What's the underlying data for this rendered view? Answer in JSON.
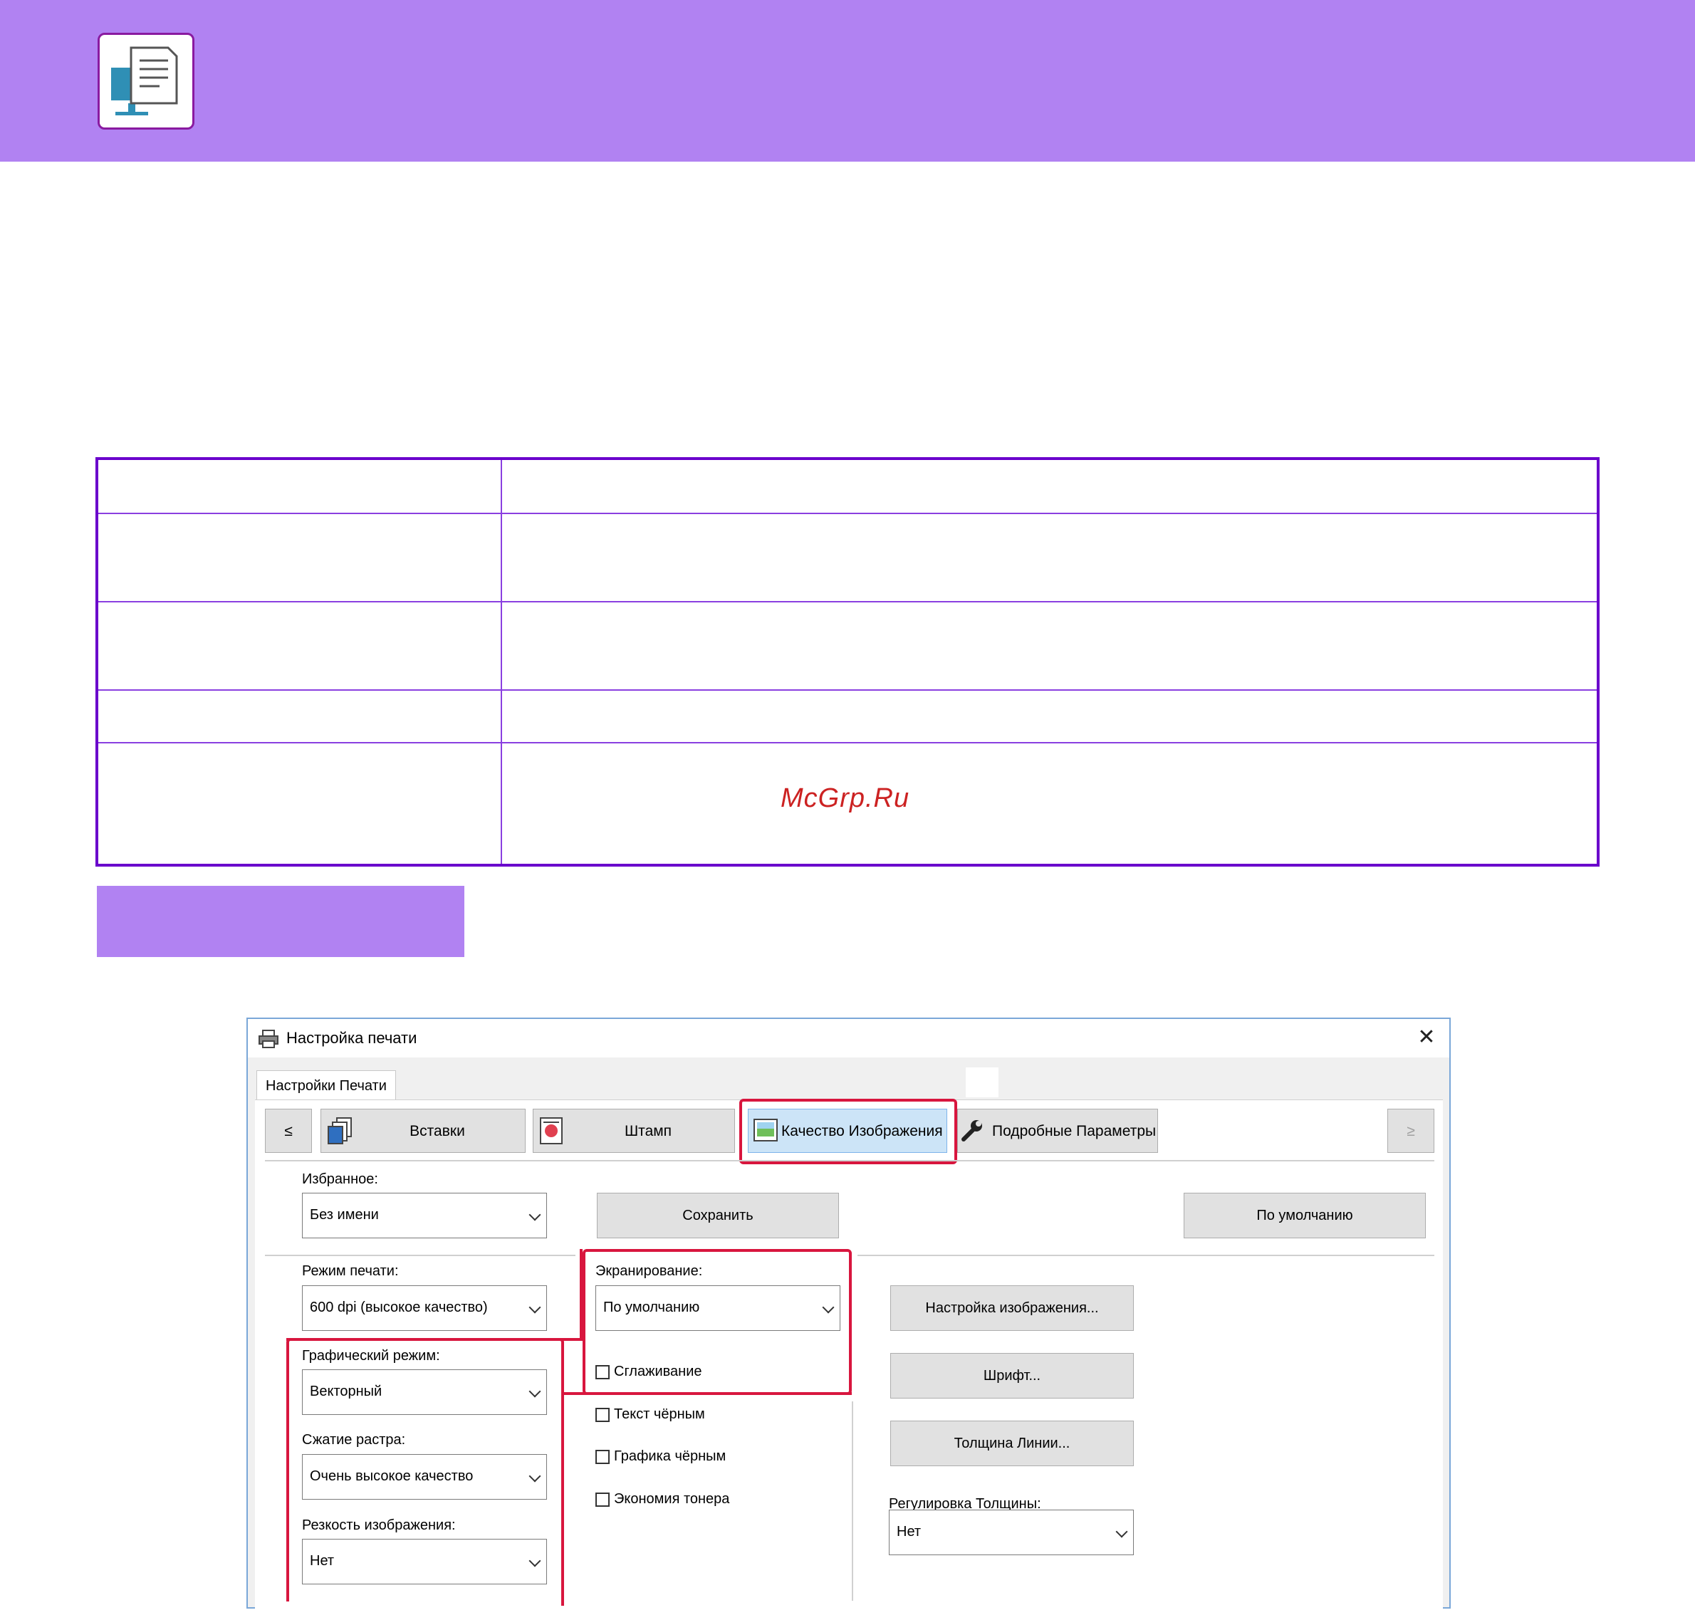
{
  "watermark": "McGrp.Ru",
  "dialog": {
    "title": "Настройка печати",
    "close_glyph": "✕",
    "main_tab": "Настройки Печати",
    "tabs": [
      {
        "label": "≤"
      },
      {
        "label": "Вставки"
      },
      {
        "label": "Штамп"
      },
      {
        "label": "Качество Изображения"
      },
      {
        "label": "Подробные Параметры"
      },
      {
        "label": "≥"
      }
    ],
    "favorites": {
      "label": "Избранное:",
      "value": "Без имени"
    },
    "save_label": "Сохранить",
    "default_label": "По умолчанию",
    "print_mode": {
      "label": "Режим печати:",
      "value": "600 dpi (высокое качество)"
    },
    "screening": {
      "label": "Экранирование:",
      "value": "По умолчанию"
    },
    "graphics_mode": {
      "label": "Графический режим:",
      "value": "Векторный"
    },
    "raster_compression": {
      "label": "Сжатие растра:",
      "value": "Очень высокое качество"
    },
    "sharpness": {
      "label": "Резкость изображения:",
      "value": "Нет"
    },
    "checkboxes": {
      "smoothing": "Сглаживание",
      "text_black": "Текст чёрным",
      "graphics_black": "Графика чёрным",
      "toner_save": "Экономия тонера"
    },
    "image_settings_label": "Настройка изображения...",
    "font_label": "Шрифт...",
    "line_width_label": "Толщина Линии...",
    "thickness": {
      "label": "Регулировка Толщины:",
      "value": "Нет"
    }
  }
}
